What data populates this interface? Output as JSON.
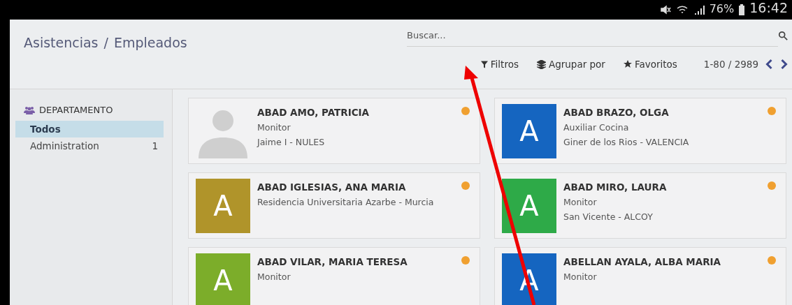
{
  "status_bar": {
    "battery": "76%",
    "time": "16:42"
  },
  "breadcrumb": {
    "parent": "Asistencias",
    "separator": "/",
    "current": "Empleados"
  },
  "search": {
    "placeholder": "Buscar..."
  },
  "toolbar": {
    "filters": "Filtros",
    "group_by": "Agrupar por",
    "favorites": "Favoritos",
    "pager": "1-80 / 2989"
  },
  "sidebar": {
    "title": "DEPARTAMENTO",
    "items": [
      {
        "label": "Todos",
        "selected": true
      },
      {
        "label": "Administration",
        "count": "1",
        "selected": false
      }
    ]
  },
  "employees": [
    {
      "name": "ABAD AMO, PATRICIA",
      "lines": [
        "Monitor",
        "Jaime I - NULES"
      ],
      "avatar": {
        "kind": "silhouette"
      },
      "color": "#f0a030"
    },
    {
      "name": "ABAD BRAZO, OLGA",
      "lines": [
        "Auxiliar Cocina",
        "Giner de los Rios - VALENCIA"
      ],
      "avatar": {
        "kind": "letter",
        "letter": "A",
        "color": "#1565c0"
      },
      "color": "#f0a030"
    },
    {
      "name": "ABAD IGLESIAS, ANA MARIA",
      "lines": [
        "Residencia Universitaria Azarbe - Murcia"
      ],
      "avatar": {
        "kind": "letter",
        "letter": "A",
        "color": "#b0942a"
      },
      "color": "#f0a030"
    },
    {
      "name": "ABAD MIRO, LAURA",
      "lines": [
        "Monitor",
        "San Vicente - ALCOY"
      ],
      "avatar": {
        "kind": "letter",
        "letter": "A",
        "color": "#2eaa48"
      },
      "color": "#f0a030"
    },
    {
      "name": "ABAD VILAR, MARIA TERESA",
      "lines": [
        "Monitor"
      ],
      "avatar": {
        "kind": "letter",
        "letter": "A",
        "color": "#7cad2a"
      },
      "color": "#f0a030"
    },
    {
      "name": "ABELLAN AYALA, ALBA MARIA",
      "lines": [
        "Monitor"
      ],
      "avatar": {
        "kind": "letter",
        "letter": "A",
        "color": "#1565c0"
      },
      "color": "#f0a030"
    }
  ]
}
